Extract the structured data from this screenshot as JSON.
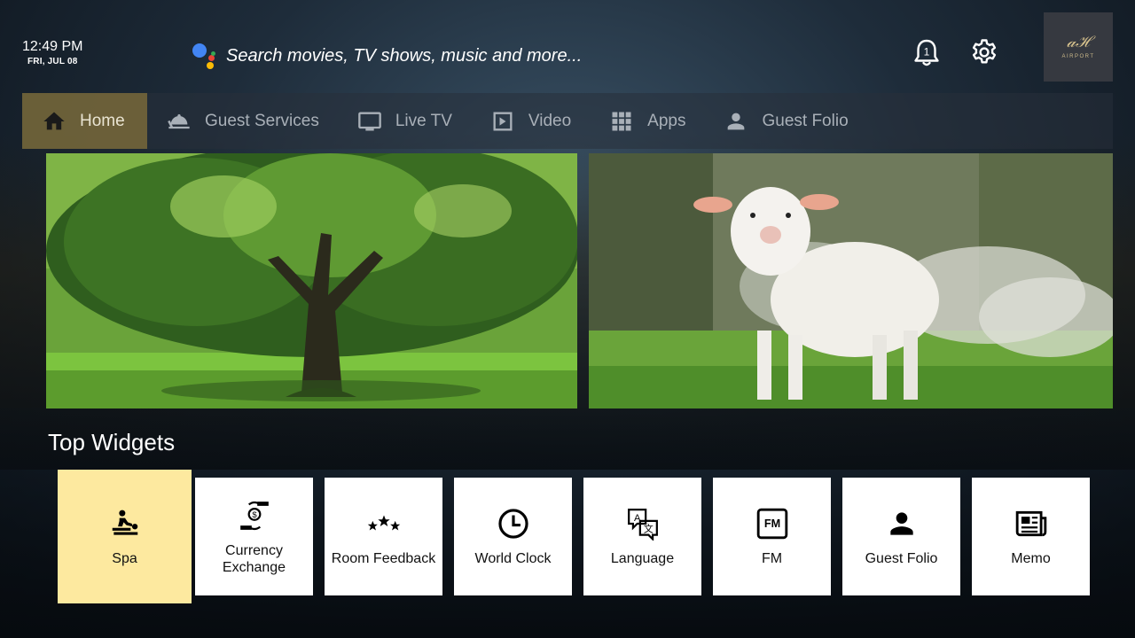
{
  "clock": {
    "time": "12:49 PM",
    "date": "FRI, JUL 08"
  },
  "search": {
    "placeholder": "Search movies, TV shows, music and more..."
  },
  "notifications": {
    "count": "1"
  },
  "brand": {
    "mark": "𝒶ℋ",
    "name": "AIRPORT"
  },
  "nav": {
    "items": [
      {
        "label": "Home",
        "icon": "home-icon",
        "active": true
      },
      {
        "label": "Guest Services",
        "icon": "bell-service-icon"
      },
      {
        "label": "Live TV",
        "icon": "tv-icon"
      },
      {
        "label": "Video",
        "icon": "play-icon"
      },
      {
        "label": "Apps",
        "icon": "apps-grid-icon"
      },
      {
        "label": "Guest Folio",
        "icon": "person-icon"
      }
    ]
  },
  "banners": [
    {
      "name": "tree-banner"
    },
    {
      "name": "lamb-banner"
    }
  ],
  "widgets": {
    "title": "Top Widgets",
    "items": [
      {
        "label": "Spa",
        "icon": "spa-icon",
        "active": true
      },
      {
        "label": "Currency",
        "label2": "Exchange",
        "icon": "currency-exchange-icon"
      },
      {
        "label": "Room Feedback",
        "icon": "stars-icon"
      },
      {
        "label": "World Clock",
        "icon": "clock-icon"
      },
      {
        "label": "Language",
        "icon": "translate-icon"
      },
      {
        "label": "FM",
        "icon": "fm-radio-icon"
      },
      {
        "label": "Guest Folio",
        "icon": "person-icon"
      },
      {
        "label": "Memo",
        "icon": "newspaper-icon"
      }
    ]
  },
  "colors": {
    "active_nav": "#78683a",
    "active_widget": "#fde99f",
    "widget_bg": "#ffffff"
  }
}
